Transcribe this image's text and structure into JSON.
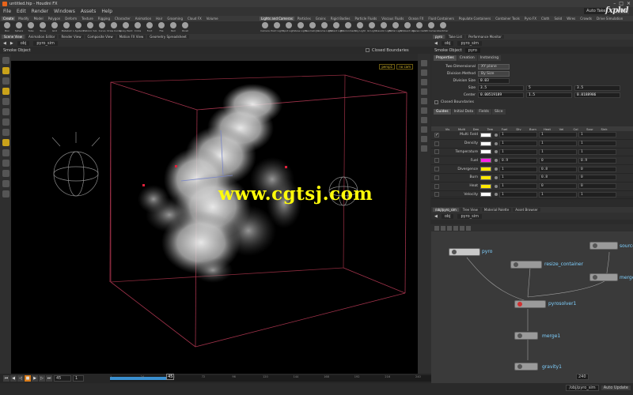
{
  "window": {
    "title": "untitled.hip - Houdini FX"
  },
  "menu": {
    "items": [
      "File",
      "Edit",
      "Render",
      "Windows",
      "Assets",
      "Help"
    ],
    "auto_takes": "Auto Takes",
    "main": "Main"
  },
  "logo_text": "fxphd",
  "shelf_left": {
    "tabs": [
      "Create",
      "Modify",
      "Model",
      "Polygon",
      "Deform",
      "Texture",
      "Rigging",
      "Character",
      "Animation",
      "Hair",
      "Grooming",
      "Cloud FX",
      "Volume"
    ],
    "active_tab": 0,
    "tools": [
      "Box",
      "Sphere",
      "Tube",
      "Torus",
      "Grid",
      "Metaball",
      "L-System",
      "Platonic Sol.",
      "Curve",
      "Draw Curve",
      "Spray Paint",
      "Circle",
      "Font",
      "File",
      "Null",
      "Rivet"
    ]
  },
  "shelf_right": {
    "tabs": [
      "Lights and Cameras",
      "Particles",
      "Grains",
      "Rigid Bodies",
      "Particle Fluids",
      "Viscous Fluids",
      "Ocean FX",
      "Fluid Containers",
      "Populate Containers",
      "Container Tools",
      "Pyro FX",
      "Cloth",
      "Solid",
      "Wires",
      "Crowds",
      "Drive Simulation"
    ],
    "active_tab": 0,
    "tools": [
      "Camera",
      "Point Light",
      "Spot Light",
      "Area Light",
      "Geometry L.",
      "Volume Light",
      "Distant Light",
      "Environment",
      "Sky Light",
      "GI Light",
      "Caustic Light",
      "Portal Light",
      "Ambient Lig.",
      "Stereo Cam.",
      "VR Camera",
      "Switcher"
    ]
  },
  "viewer": {
    "tabs": [
      "Scene View",
      "Animation Editor",
      "Render View",
      "Composite View",
      "Motion FX View",
      "Geometry Spreadsheet"
    ],
    "active_tab": 0,
    "path": [
      "obj",
      "pyro_sim"
    ],
    "header_title": "Smoke Object",
    "header_checkbox": "Closed Boundaries",
    "view_menu": [
      "persp1",
      "no cam"
    ]
  },
  "watermark": "www.cgtsj.com",
  "params": {
    "pane_tabs": [
      "pyro",
      "Take List",
      "Performance Monitor"
    ],
    "active_tab": 0,
    "path": [
      "obj",
      "pyro_sim"
    ],
    "node_type": "Smoke Object",
    "node_name": "pyro",
    "tabs": [
      "Properties",
      "Creation",
      "Instancing"
    ],
    "active_tab_index": 0,
    "rows": [
      {
        "label": "Two Dimensional",
        "dropdown": "XY plane"
      },
      {
        "label": "Division Method",
        "dropdown": "By Size"
      },
      {
        "label": "Division Size",
        "values": [
          "0.03"
        ]
      },
      {
        "label": "Size",
        "values": [
          "3.5",
          "5",
          "3.5"
        ]
      },
      {
        "label": "Center",
        "values": [
          "0.00519189",
          "1.5",
          "0.0188986"
        ]
      }
    ],
    "closed_boundaries": "Closed Boundaries",
    "field_tabs": [
      "Guides",
      "Initial Data",
      "Fields",
      "Slice"
    ],
    "field_tab_active": 0,
    "field_columns": [
      "Vis",
      "Multi",
      "Den",
      "Tem",
      "Fuel",
      "Div",
      "Burn",
      "Heat",
      "Vel",
      "Col",
      "Sour",
      "Sink"
    ],
    "fields": [
      {
        "name": "Multi Field",
        "color": "#ffffff",
        "vals": [
          "1",
          "1",
          "1"
        ],
        "checked": true
      },
      {
        "name": "Density",
        "color": "#ffffff",
        "vals": [
          "1",
          "1",
          "1"
        ],
        "checked": false
      },
      {
        "name": "Temperature",
        "color": "#ffffff",
        "vals": [
          "1",
          "1",
          "1"
        ],
        "checked": false
      },
      {
        "name": "Fuel",
        "color": "#ff20e8",
        "vals": [
          "0.9",
          "0",
          "0.9"
        ],
        "checked": false
      },
      {
        "name": "Divergence",
        "color": "#ffe800",
        "vals": [
          "1",
          "0.8",
          "0"
        ],
        "checked": false
      },
      {
        "name": "Burn",
        "color": "#ffe800",
        "vals": [
          "1",
          "0.8",
          "0"
        ],
        "checked": false
      },
      {
        "name": "Heat",
        "color": "#ffe800",
        "vals": [
          "1",
          "0",
          "0"
        ],
        "checked": false
      },
      {
        "name": "Velocity",
        "color": "#ffffff",
        "vals": [
          "1",
          "1",
          "1"
        ],
        "checked": false
      }
    ]
  },
  "network": {
    "pane_tabs": [
      "/obj/pyro_sim",
      "Tree View",
      "Material Palette",
      "Asset Browser"
    ],
    "active_tab": 0,
    "path": [
      "obj",
      "pyro_sim"
    ],
    "nodes": [
      "pyro",
      "resize_container",
      "pyrosolver1",
      "merge1",
      "gravity1",
      "source",
      "merge"
    ]
  },
  "timeline": {
    "current_frame": "45",
    "start": "1",
    "end": "240",
    "ticks": [
      "1",
      "24",
      "48",
      "72",
      "96",
      "120",
      "144",
      "168",
      "192",
      "216",
      "240"
    ],
    "range_label": "1",
    "progress": 0.19
  },
  "status": {
    "path": "/obj/pyro_sim",
    "auto_update": "Auto Update"
  }
}
